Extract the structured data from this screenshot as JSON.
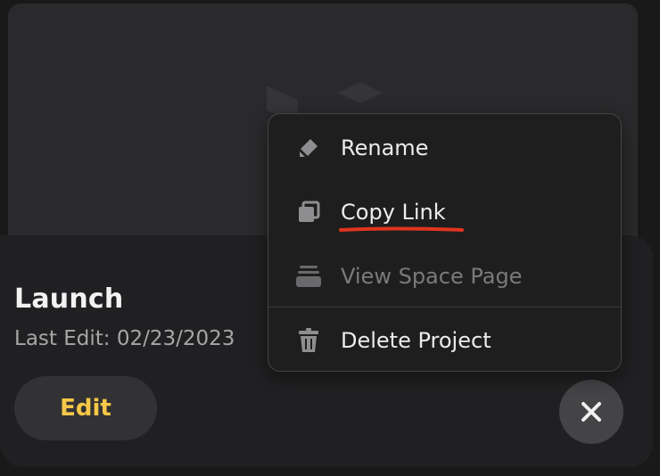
{
  "project": {
    "title": "Launch",
    "last_edit": "Last Edit: 02/23/2023",
    "edit_label": "Edit"
  },
  "context_menu": {
    "items": [
      {
        "label": "Rename",
        "icon": "pencil-icon",
        "enabled": true
      },
      {
        "label": "Copy Link",
        "icon": "copy-icon",
        "enabled": true,
        "underlined": true
      },
      {
        "label": "View Space Page",
        "icon": "stack-icon",
        "enabled": false
      },
      {
        "label": "Delete Project",
        "icon": "trash-icon",
        "enabled": true
      }
    ]
  },
  "colors": {
    "accent": "#f7c748",
    "annotation_underline": "#e0341f",
    "menu_bg": "#1e1e1f",
    "card_bg": "#202022"
  }
}
